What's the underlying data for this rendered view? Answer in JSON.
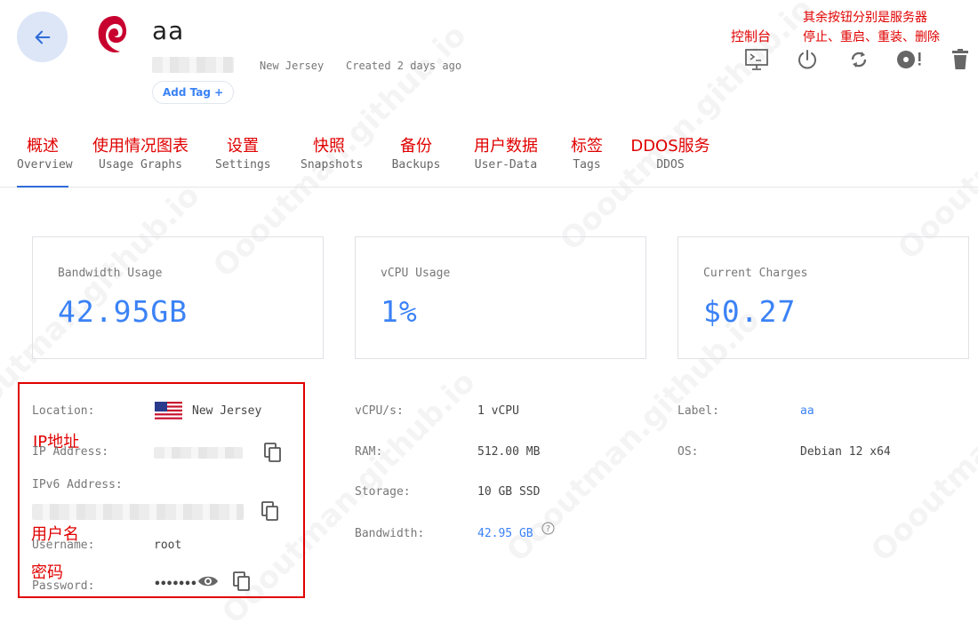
{
  "header": {
    "server_name": "aa",
    "location": "New Jersey",
    "created": "Created 2 days ago",
    "add_tag": "Add Tag +"
  },
  "annotations": {
    "console": "控制台",
    "buttons_line1": "其余按钮分别是服务器",
    "buttons_line2": "停止、重启、重装、删除",
    "ip": "IP地址",
    "username": "用户名",
    "password": "密码"
  },
  "toolbar": {
    "icons": [
      "console-icon",
      "power-icon",
      "restart-icon",
      "reinstall-icon",
      "delete-icon"
    ]
  },
  "tabs": [
    {
      "cn": "概述",
      "en": "Overview"
    },
    {
      "cn": "使用情况图表",
      "en": "Usage Graphs"
    },
    {
      "cn": "设置",
      "en": "Settings"
    },
    {
      "cn": "快照",
      "en": "Snapshots"
    },
    {
      "cn": "备份",
      "en": "Backups"
    },
    {
      "cn": "用户数据",
      "en": "User-Data"
    },
    {
      "cn": "标签",
      "en": "Tags"
    },
    {
      "cn": "DDOS服务",
      "en": "DDOS"
    }
  ],
  "cards": [
    {
      "label": "Bandwidth Usage",
      "value": "42.95GB"
    },
    {
      "label": "vCPU Usage",
      "value": "1%"
    },
    {
      "label": "Current Charges",
      "value": "$0.27"
    }
  ],
  "details": {
    "location_label": "Location:",
    "location_value": "New Jersey",
    "ip_label": "IP Address:",
    "ipv6_label": "IPv6 Address:",
    "username_label": "Username:",
    "username_value": "root",
    "password_label": "Password:",
    "password_value": "•••••••",
    "vcpu_label": "vCPU/s:",
    "vcpu_value": "1 vCPU",
    "ram_label": "RAM:",
    "ram_value": "512.00 MB",
    "storage_label": "Storage:",
    "storage_value": "10 GB SSD",
    "bandwidth_label": "Bandwidth:",
    "bandwidth_value": "42.95 GB",
    "label_label": "Label:",
    "label_value": "aa",
    "os_label": "OS:",
    "os_value": "Debian 12 x64"
  },
  "watermark": "Oooutman.github.io",
  "colors": {
    "accent": "#3b82f6",
    "annotation": "#e00000",
    "back_bg": "#dce6f7"
  }
}
